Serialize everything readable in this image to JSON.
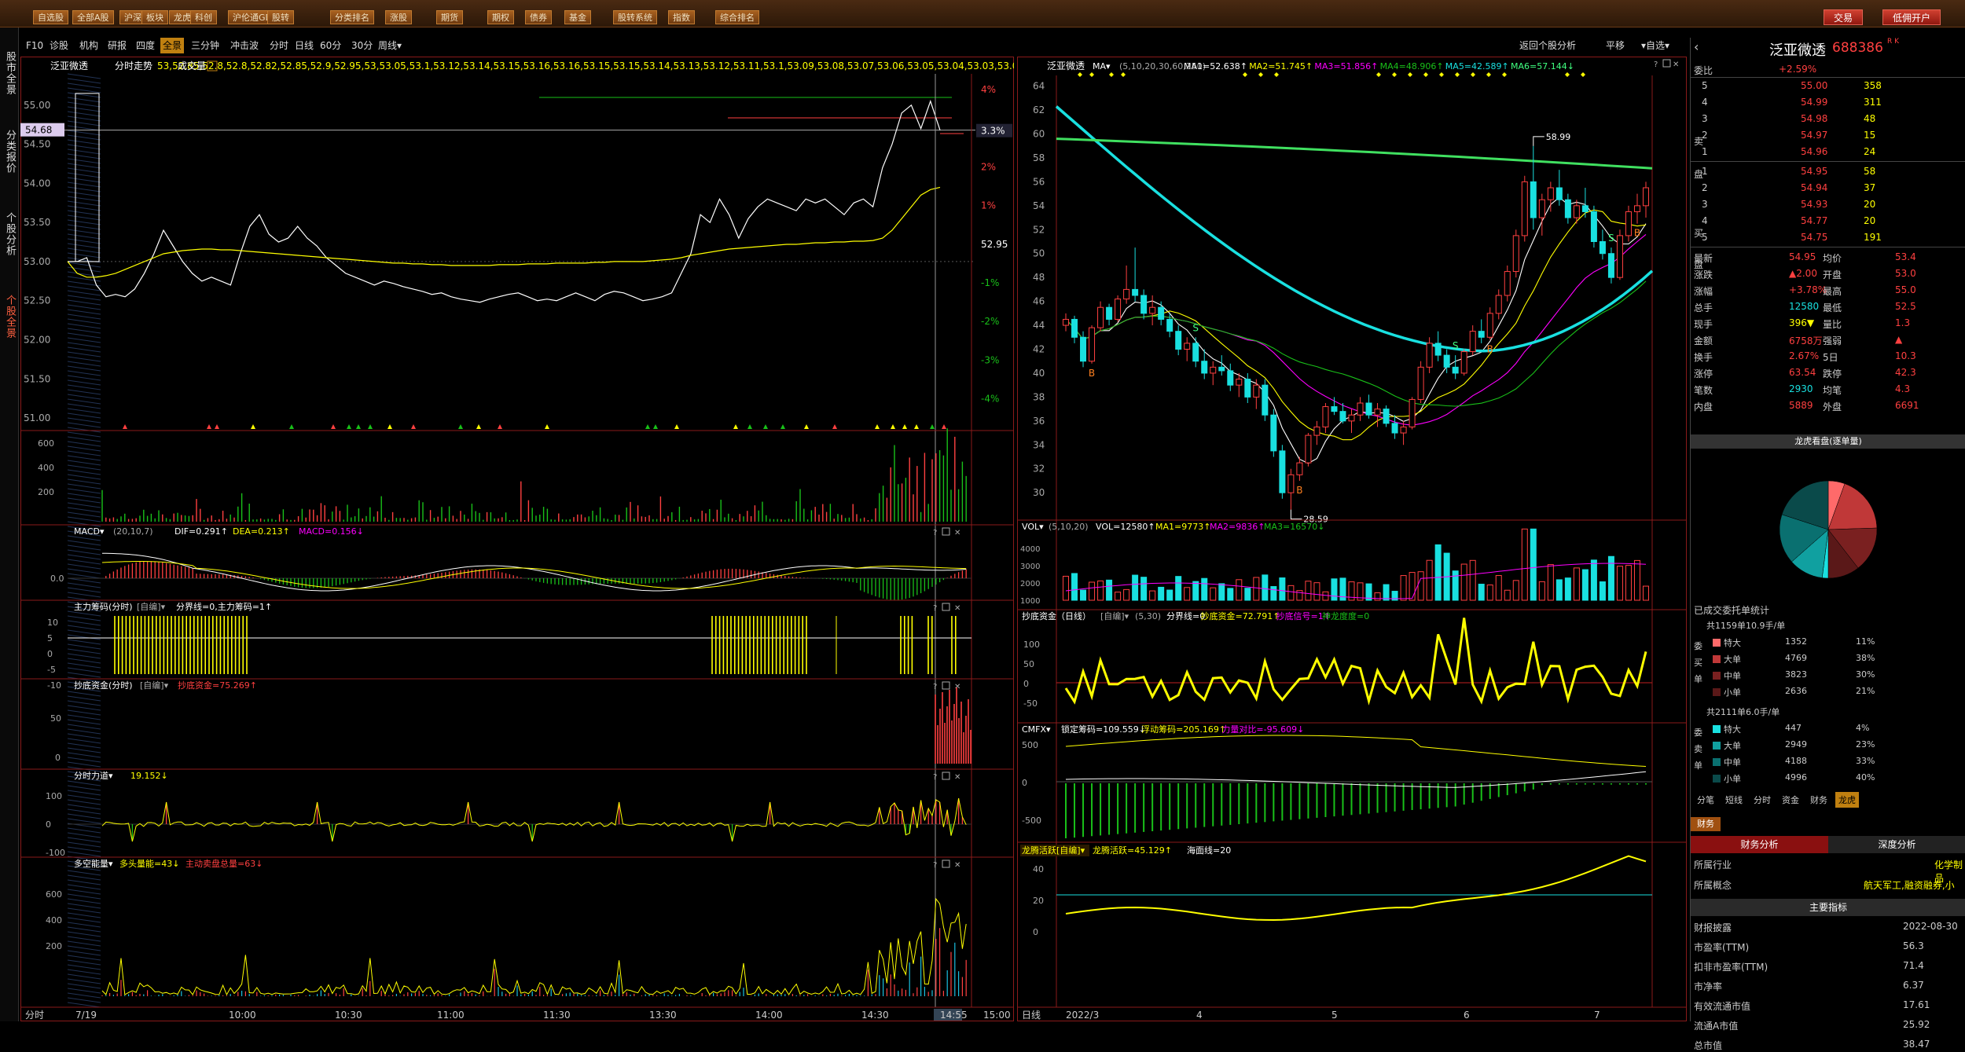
{
  "toolbar": {
    "items": [
      "自选股",
      "全部A股",
      "沪深",
      "板块",
      "龙虎",
      "科创",
      "沪伦通GDR",
      "股转",
      "分类排名",
      "涨股",
      "期货",
      "期权",
      "债券",
      "基金",
      "股转系统",
      "指数",
      "综合排名"
    ],
    "trade": "交易",
    "open_account": "低佣开户"
  },
  "row2": {
    "items": [
      "F10",
      "诊股",
      "机构",
      "研报",
      "四度",
      "全景",
      "三分钟",
      "冲击波",
      "分时",
      "日线",
      "60分",
      "30分",
      "周线▾"
    ],
    "right": [
      "返回个股分析",
      "平移",
      "▾自选▾"
    ]
  },
  "sidebar": [
    "股市全景",
    "分类报价",
    "个股分析",
    "个股全景"
  ],
  "colors": {
    "up": "#ff4040",
    "down": "#19e0e0",
    "yellow": "#ffff40",
    "green": "#19c019",
    "frame": "#8a1a1a"
  },
  "intraday": {
    "title": "泛亚微透",
    "subtitle": "分时走势",
    "avg": [
      53,
      52.85,
      52.8,
      52.8,
      52.82,
      52.85,
      52.9,
      52.95,
      53.0,
      53.05,
      53.1,
      53.12,
      53.14,
      53.15,
      53.16,
      53.16,
      53.15,
      53.15,
      53.14,
      53.13,
      53.12,
      53.11,
      53.1,
      53.09,
      53.08,
      53.07,
      53.06,
      53.05,
      53.04,
      53.03,
      53.02,
      53.01,
      53.0,
      52.99,
      52.98,
      52.98,
      52.97,
      52.97,
      52.96,
      52.96,
      52.95,
      52.95,
      52.95,
      52.95,
      52.95,
      52.96,
      52.96,
      52.96,
      52.97,
      52.97,
      52.97,
      52.98,
      52.98,
      52.98,
      52.98,
      52.99,
      52.99,
      53.0,
      53.0,
      53.0,
      53.0,
      53.01,
      53.02,
      53.03,
      53.05,
      53.08,
      53.1,
      53.12,
      53.14,
      53.16,
      53.17,
      53.18,
      53.19,
      53.2,
      53.21,
      53.22,
      53.22,
      53.23,
      53.24,
      53.24,
      53.25,
      53.25,
      53.26,
      53.26,
      53.27,
      53.3,
      53.4,
      53.55,
      53.7,
      53.85,
      53.92,
      53.95
    ],
    "vol": "成交量",
    "last_price": "54.68",
    "last_pct": "3.3%",
    "y_left": [
      "55.00",
      "54.50",
      "54.00",
      "53.50",
      "53.00",
      "52.50",
      "52.00",
      "51.50",
      "51.00"
    ],
    "y_right": [
      "4%",
      "3%",
      "2%",
      "1%",
      "52.95",
      "-1%",
      "-2%",
      "-3%",
      "-4%"
    ],
    "vol_axis": [
      "600",
      "400",
      "200"
    ],
    "time_axis": [
      "7/19",
      "10:00",
      "10:30",
      "11:00",
      "11:30",
      "13:30",
      "14:00",
      "14:30",
      "14:55",
      "15:00"
    ],
    "foot_left": "分时",
    "price": [
      53,
      53,
      53.05,
      52.7,
      52.55,
      52.58,
      52.55,
      52.65,
      52.85,
      53.1,
      53.4,
      53.2,
      53.0,
      52.85,
      52.75,
      52.8,
      52.75,
      52.7,
      53.1,
      53.45,
      53.6,
      53.35,
      53.25,
      53.3,
      53.45,
      53.3,
      53.2,
      53.05,
      52.95,
      52.85,
      52.8,
      52.75,
      52.7,
      52.75,
      52.72,
      52.68,
      52.65,
      52.62,
      52.58,
      52.6,
      52.55,
      52.52,
      52.5,
      52.48,
      52.52,
      52.55,
      52.58,
      52.6,
      52.55,
      52.5,
      52.52,
      52.5,
      52.55,
      52.6,
      52.55,
      52.5,
      52.58,
      52.62,
      52.6,
      52.55,
      52.5,
      52.52,
      52.55,
      52.6,
      52.85,
      53.1,
      53.6,
      53.5,
      53.8,
      53.6,
      53.3,
      53.55,
      53.7,
      53.8,
      53.75,
      53.7,
      53.65,
      53.8,
      53.75,
      53.8,
      53.7,
      53.6,
      53.75,
      53.8,
      53.7,
      54.2,
      54.5,
      54.9,
      55.0,
      54.7,
      55.05,
      54.68
    ]
  },
  "macd_l": {
    "title": "MACD▾",
    "params": "(20,10,7)",
    "dif": "DIF=0.291↑",
    "dea": "DEA=0.213↑",
    "macd": "MACD=0.156↓",
    "axis": "0.0"
  },
  "zljm": {
    "title": "主力筹码(分时)",
    "mode": "[自编]▾",
    "line": "分界线=0,主力筹码=1↑",
    "axis": [
      "10",
      "5",
      "0",
      "-5",
      "-10"
    ]
  },
  "cdzj_l": {
    "title": "抄底资金(分时)",
    "mode": "[自编]▾",
    "val": "抄底资金=75.269↑",
    "axis": [
      "50",
      "0"
    ]
  },
  "fsld": {
    "title": "分时力道▾",
    "val": "19.152↓",
    "axis": [
      "100",
      "0",
      "-100"
    ]
  },
  "dkn": {
    "title": "多空能量▾",
    "val1": "多头量能=43↓",
    "val2": "主动卖盘总量=63↓",
    "axis": [
      "600",
      "400",
      "200"
    ]
  },
  "daily": {
    "title": "泛亚微透",
    "ma_label": "MA▾",
    "params": "(5,10,20,30,60,250)",
    "ma": [
      "MA1=52.638↑",
      "MA2=51.745↑",
      "MA3=51.856↑",
      "MA4=48.906↑",
      "MA5=42.589↑",
      "MA6=57.144↓"
    ],
    "y": [
      "64",
      "62",
      "60",
      "58",
      "56",
      "54",
      "52",
      "50",
      "48",
      "46",
      "44",
      "42",
      "40",
      "38",
      "36",
      "34",
      "32",
      "30"
    ],
    "high_label": "58.99",
    "low_label": "28.59",
    "time_axis": [
      "2022/3",
      "4",
      "5",
      "6",
      "7"
    ],
    "foot_left": "日线",
    "ohlc": [
      [
        44,
        45,
        43.5,
        44.5
      ],
      [
        44.5,
        44.8,
        42.5,
        43
      ],
      [
        43,
        43.5,
        40.5,
        41
      ],
      [
        41,
        44,
        40.8,
        43.8
      ],
      [
        43.8,
        46,
        43.5,
        45.5
      ],
      [
        45.5,
        45.8,
        44,
        44.5
      ],
      [
        44.5,
        46.5,
        44.3,
        46.2
      ],
      [
        46.2,
        49,
        45.8,
        47
      ],
      [
        47,
        50.5,
        46,
        46.5
      ],
      [
        46.5,
        47,
        44.5,
        45
      ],
      [
        45,
        46.5,
        44,
        45.5
      ],
      [
        45.5,
        46,
        44,
        44.5
      ],
      [
        44.5,
        45,
        43,
        43.5
      ],
      [
        43.5,
        44,
        41.5,
        42
      ],
      [
        42,
        43,
        41,
        42.5
      ],
      [
        42.5,
        43,
        40.5,
        41
      ],
      [
        41,
        42,
        39.5,
        40
      ],
      [
        40,
        41,
        39,
        40.5
      ],
      [
        40.5,
        41.5,
        39.8,
        40.2
      ],
      [
        40.2,
        40.8,
        38.5,
        39
      ],
      [
        39,
        40,
        38,
        39.5
      ],
      [
        39.5,
        40,
        37.5,
        38
      ],
      [
        38,
        39.5,
        37,
        39
      ],
      [
        39,
        39.5,
        36,
        36.5
      ],
      [
        36.5,
        37,
        33,
        33.5
      ],
      [
        33.5,
        34,
        29.5,
        30
      ],
      [
        30,
        32,
        28.59,
        31.5
      ],
      [
        31.5,
        33,
        31,
        32.5
      ],
      [
        32.5,
        35,
        32.2,
        34.8
      ],
      [
        34.8,
        36,
        34,
        35.5
      ],
      [
        35.5,
        37.5,
        35,
        37.2
      ],
      [
        37.2,
        38,
        36.5,
        36.8
      ],
      [
        36.8,
        37.5,
        35.8,
        36
      ],
      [
        36,
        37,
        35,
        36.5
      ],
      [
        36.5,
        38,
        36,
        37.5
      ],
      [
        37.5,
        38.2,
        36.2,
        36.5
      ],
      [
        36.5,
        37.5,
        35.5,
        37
      ],
      [
        37,
        37.3,
        35.5,
        35.8
      ],
      [
        35.8,
        36.5,
        34.5,
        35
      ],
      [
        35,
        36,
        34,
        35.5
      ],
      [
        35.5,
        38,
        35.3,
        37.8
      ],
      [
        37.8,
        41,
        37.5,
        40.5
      ],
      [
        40.5,
        43,
        40,
        42.5
      ],
      [
        42.5,
        43.5,
        41,
        41.5
      ],
      [
        41.5,
        42,
        40,
        40.5
      ],
      [
        40.5,
        41.5,
        39.5,
        40
      ],
      [
        40,
        42,
        39.8,
        41.8
      ],
      [
        41.8,
        44,
        41.5,
        43.5
      ],
      [
        43.5,
        44.5,
        42.5,
        43
      ],
      [
        43,
        45.5,
        42.8,
        45
      ],
      [
        45,
        47,
        44.5,
        46.5
      ],
      [
        46.5,
        49,
        46,
        48.5
      ],
      [
        48.5,
        52,
        48,
        51.5
      ],
      [
        51.5,
        56.5,
        51,
        56
      ],
      [
        56,
        58.99,
        52,
        53
      ],
      [
        53,
        55,
        51.5,
        54.5
      ],
      [
        54.5,
        56,
        53.5,
        55.5
      ],
      [
        55.5,
        57,
        54,
        54.5
      ],
      [
        54.5,
        55,
        52.5,
        53
      ],
      [
        53,
        54.5,
        52.5,
        54
      ],
      [
        54,
        55.5,
        53,
        53.5
      ],
      [
        53.5,
        54,
        50.5,
        51
      ],
      [
        51,
        52,
        49.5,
        50
      ],
      [
        50,
        50.5,
        47.5,
        48
      ],
      [
        48,
        52,
        47.8,
        51.5
      ],
      [
        51.5,
        54,
        51,
        53.5
      ],
      [
        53.5,
        55,
        52.5,
        54
      ],
      [
        54,
        56,
        53,
        55.5
      ]
    ],
    "vol_axis": [
      "4000",
      "3000",
      "2000",
      "1000"
    ],
    "vol_title": "VOL▾",
    "vol_params": "(5,10,20)",
    "vol_vals": [
      "VOL=12580↑",
      "MA1=9773↑",
      "MA2=9836↑",
      "MA3=16570↓"
    ],
    "cdzj_title": "抄底资金（日线）",
    "cdzj_mode": "[自编]▾",
    "cdzj_params": "(5,30)",
    "cdzj_vals": [
      "分界线=0",
      "抄底资金=72.791↑",
      "抄底信号=1↑",
      "神龙度度=0"
    ],
    "cdzj_axis": [
      "100",
      "50",
      "0",
      "-50"
    ],
    "cmfx_title": "CMFX▾",
    "cmfx_vals": [
      "锁定筹码=109.559↓",
      "浮动筹码=205.169↑",
      "力量对比=-95.609↓"
    ],
    "cmfx_axis": [
      "500",
      "0",
      "-500"
    ],
    "lthy_title": "龙腾活跃[自编]▾",
    "lthy_vals": [
      "龙腾活跃=45.129↑",
      "海面线=20"
    ],
    "lthy_axis": [
      "40",
      "20",
      "0"
    ]
  },
  "quote": {
    "name": "泛亚微透",
    "code": "688386",
    "wb_label": "委比",
    "wb_val": "+2.59%",
    "sell": [
      [
        "5",
        "55.00",
        "358"
      ],
      [
        "4",
        "54.99",
        "311"
      ],
      [
        "3",
        "54.98",
        "48"
      ],
      [
        "2",
        "54.97",
        "15"
      ],
      [
        "1",
        "54.96",
        "24"
      ]
    ],
    "buy": [
      [
        "1",
        "54.95",
        "58"
      ],
      [
        "2",
        "54.94",
        "37"
      ],
      [
        "3",
        "54.93",
        "20"
      ],
      [
        "4",
        "54.77",
        "20"
      ],
      [
        "5",
        "54.75",
        "191"
      ]
    ],
    "stats": [
      [
        "最新",
        "54.95",
        "均价",
        "53.4"
      ],
      [
        "涨跌",
        "▲2.00",
        "开盘",
        "53.0"
      ],
      [
        "涨幅",
        "+3.78%",
        "最高",
        "55.0"
      ],
      [
        "总手",
        "12580",
        "最低",
        "52.5"
      ],
      [
        "现手",
        "396▼",
        "量比",
        "1.3"
      ],
      [
        "金额",
        "6758万",
        "强弱",
        "▲"
      ],
      [
        "换手",
        "2.67%",
        "5日",
        "10.3"
      ],
      [
        "涨停",
        "63.54",
        "跌停",
        "42.3"
      ],
      [
        "笔数",
        "2930",
        "均笔",
        "4.3"
      ],
      [
        "内盘",
        "5889",
        "外盘",
        "6691"
      ]
    ],
    "chart_title": "龙虎看盘(逐单量)",
    "order_title": "已成交委托单统计",
    "buy_total": "共1159单10.9手/单",
    "sell_total": "共2111单6.0手/单",
    "buy_rows": [
      [
        "特大",
        "1352",
        "11%"
      ],
      [
        "大单",
        "4769",
        "38%"
      ],
      [
        "中单",
        "3823",
        "30%"
      ],
      [
        "小单",
        "2636",
        "21%"
      ]
    ],
    "sell_rows": [
      [
        "特大",
        "447",
        "4%"
      ],
      [
        "大单",
        "2949",
        "23%"
      ],
      [
        "中单",
        "4188",
        "33%"
      ],
      [
        "小单",
        "4996",
        "40%"
      ]
    ],
    "side_buy": [
      "委",
      "买",
      "单"
    ],
    "side_sell": [
      "委",
      "卖",
      "单"
    ],
    "tabs": [
      "分笔",
      "短线",
      "分时",
      "资金",
      "财务",
      "龙虎"
    ],
    "fin_tab": "财务",
    "fin_btns": [
      "财务分析",
      "深度分析"
    ],
    "industry_label": "所属行业",
    "industry": "化学制品",
    "concept_label": "所属概念",
    "concept": "航天军工,融资融券,小",
    "main_index": "主要指标",
    "metrics": [
      [
        "财报披露",
        "2022-08-30"
      ],
      [
        "市盈率(TTM)",
        "56.3"
      ],
      [
        "扣非市盈率(TTM)",
        "71.4"
      ],
      [
        "市净率",
        "6.37"
      ],
      [
        "有效流通市值",
        "17.61"
      ],
      [
        "流通A市值",
        "25.92"
      ],
      [
        "总市值",
        "38.47"
      ]
    ]
  }
}
